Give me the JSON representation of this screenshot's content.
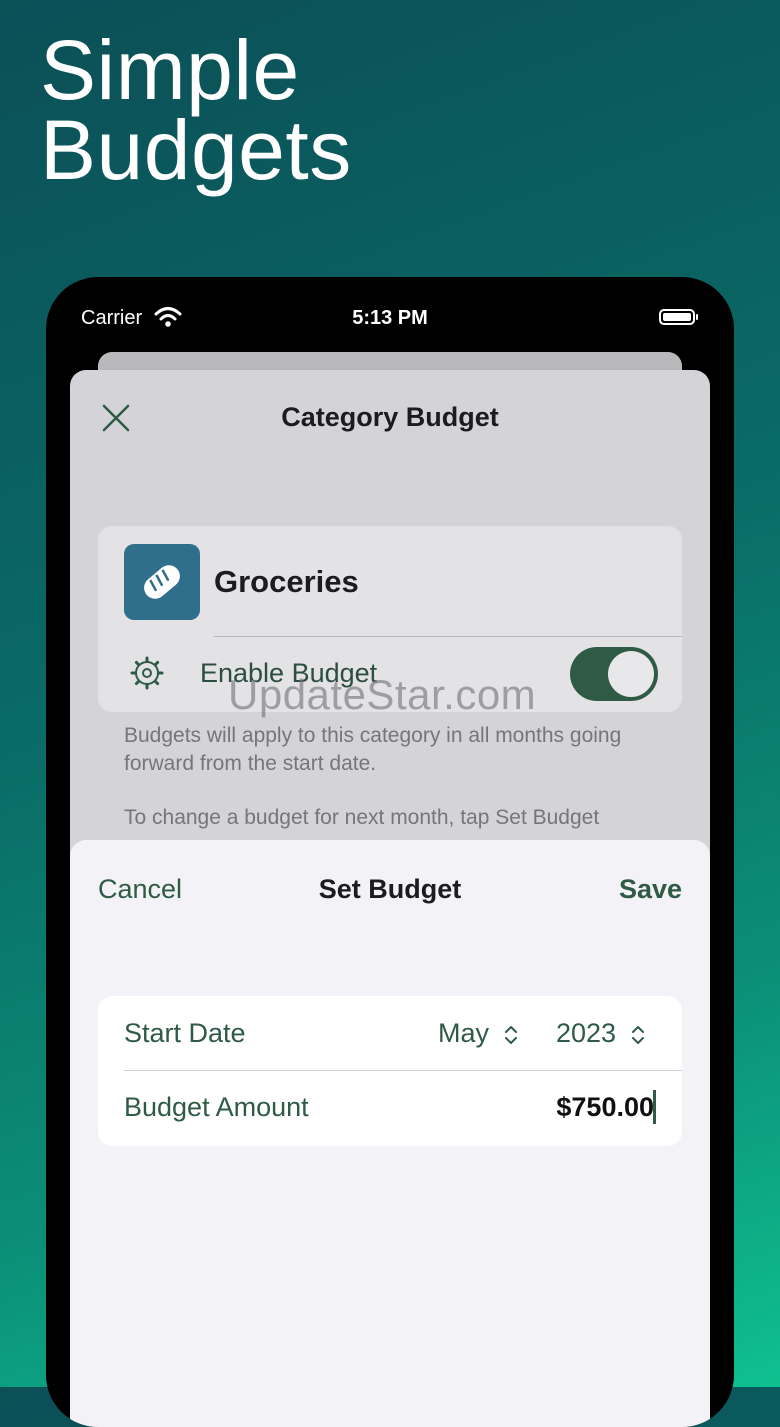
{
  "headline": {
    "line1": "Simple",
    "line2": "Budgets"
  },
  "status_bar": {
    "carrier": "Carrier",
    "time": "5:13 PM",
    "icons": [
      "wifi-icon",
      "battery-icon"
    ]
  },
  "category_sheet": {
    "title": "Category Budget",
    "close_icon": "close-icon",
    "category": {
      "name": "Groceries",
      "icon": "bread-icon"
    },
    "enable_budget": {
      "label": "Enable Budget",
      "on": true,
      "icon": "gear-icon"
    },
    "footnote_1": "Budgets will apply to this category in all months going forward from the start date.",
    "footnote_2": "To change a budget for next month, tap Set Budget"
  },
  "watermark": "UpdateStar.com",
  "set_budget": {
    "cancel_label": "Cancel",
    "title": "Set Budget",
    "save_label": "Save",
    "start_date_label": "Start Date",
    "month": "May",
    "year": "2023",
    "amount_label": "Budget Amount",
    "amount_value": "$750.00"
  },
  "colors": {
    "accent": "#2f5b45",
    "category_icon_bg": "#2f6f8c"
  }
}
